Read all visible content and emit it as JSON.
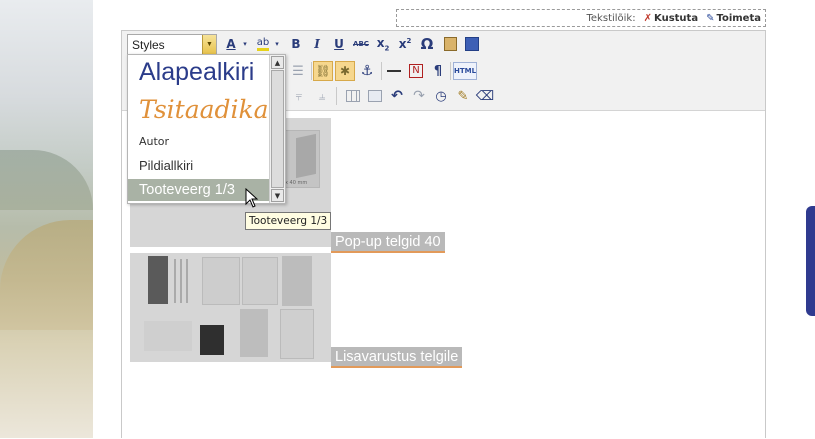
{
  "edit_bar": {
    "label": "Tekstilõik:",
    "delete_label": "Kustuta",
    "edit_label": "Toimeta"
  },
  "toolbar": {
    "styles_combo_value": "Styles",
    "html_button_label": "HTML"
  },
  "styles_dropdown": {
    "items": [
      {
        "label": "Alapealkiri"
      },
      {
        "label": "Tsitaadikast"
      },
      {
        "label": "Autor"
      },
      {
        "label": "Pildiallkiri"
      },
      {
        "label": "Tooteveerg 1/3",
        "state": "hovered"
      }
    ]
  },
  "tooltip": {
    "text": "Tooteveerg 1/3"
  },
  "content": {
    "products": [
      {
        "caption": "Pop-up telgid 40",
        "image_text": "ex 40 mm"
      },
      {
        "caption": "Lisavarustus telgile"
      }
    ]
  },
  "colors": {
    "accent_blue": "#2f3a8f",
    "highlight_orange": "#f6d78e",
    "caption_underline": "#e29a5a"
  }
}
